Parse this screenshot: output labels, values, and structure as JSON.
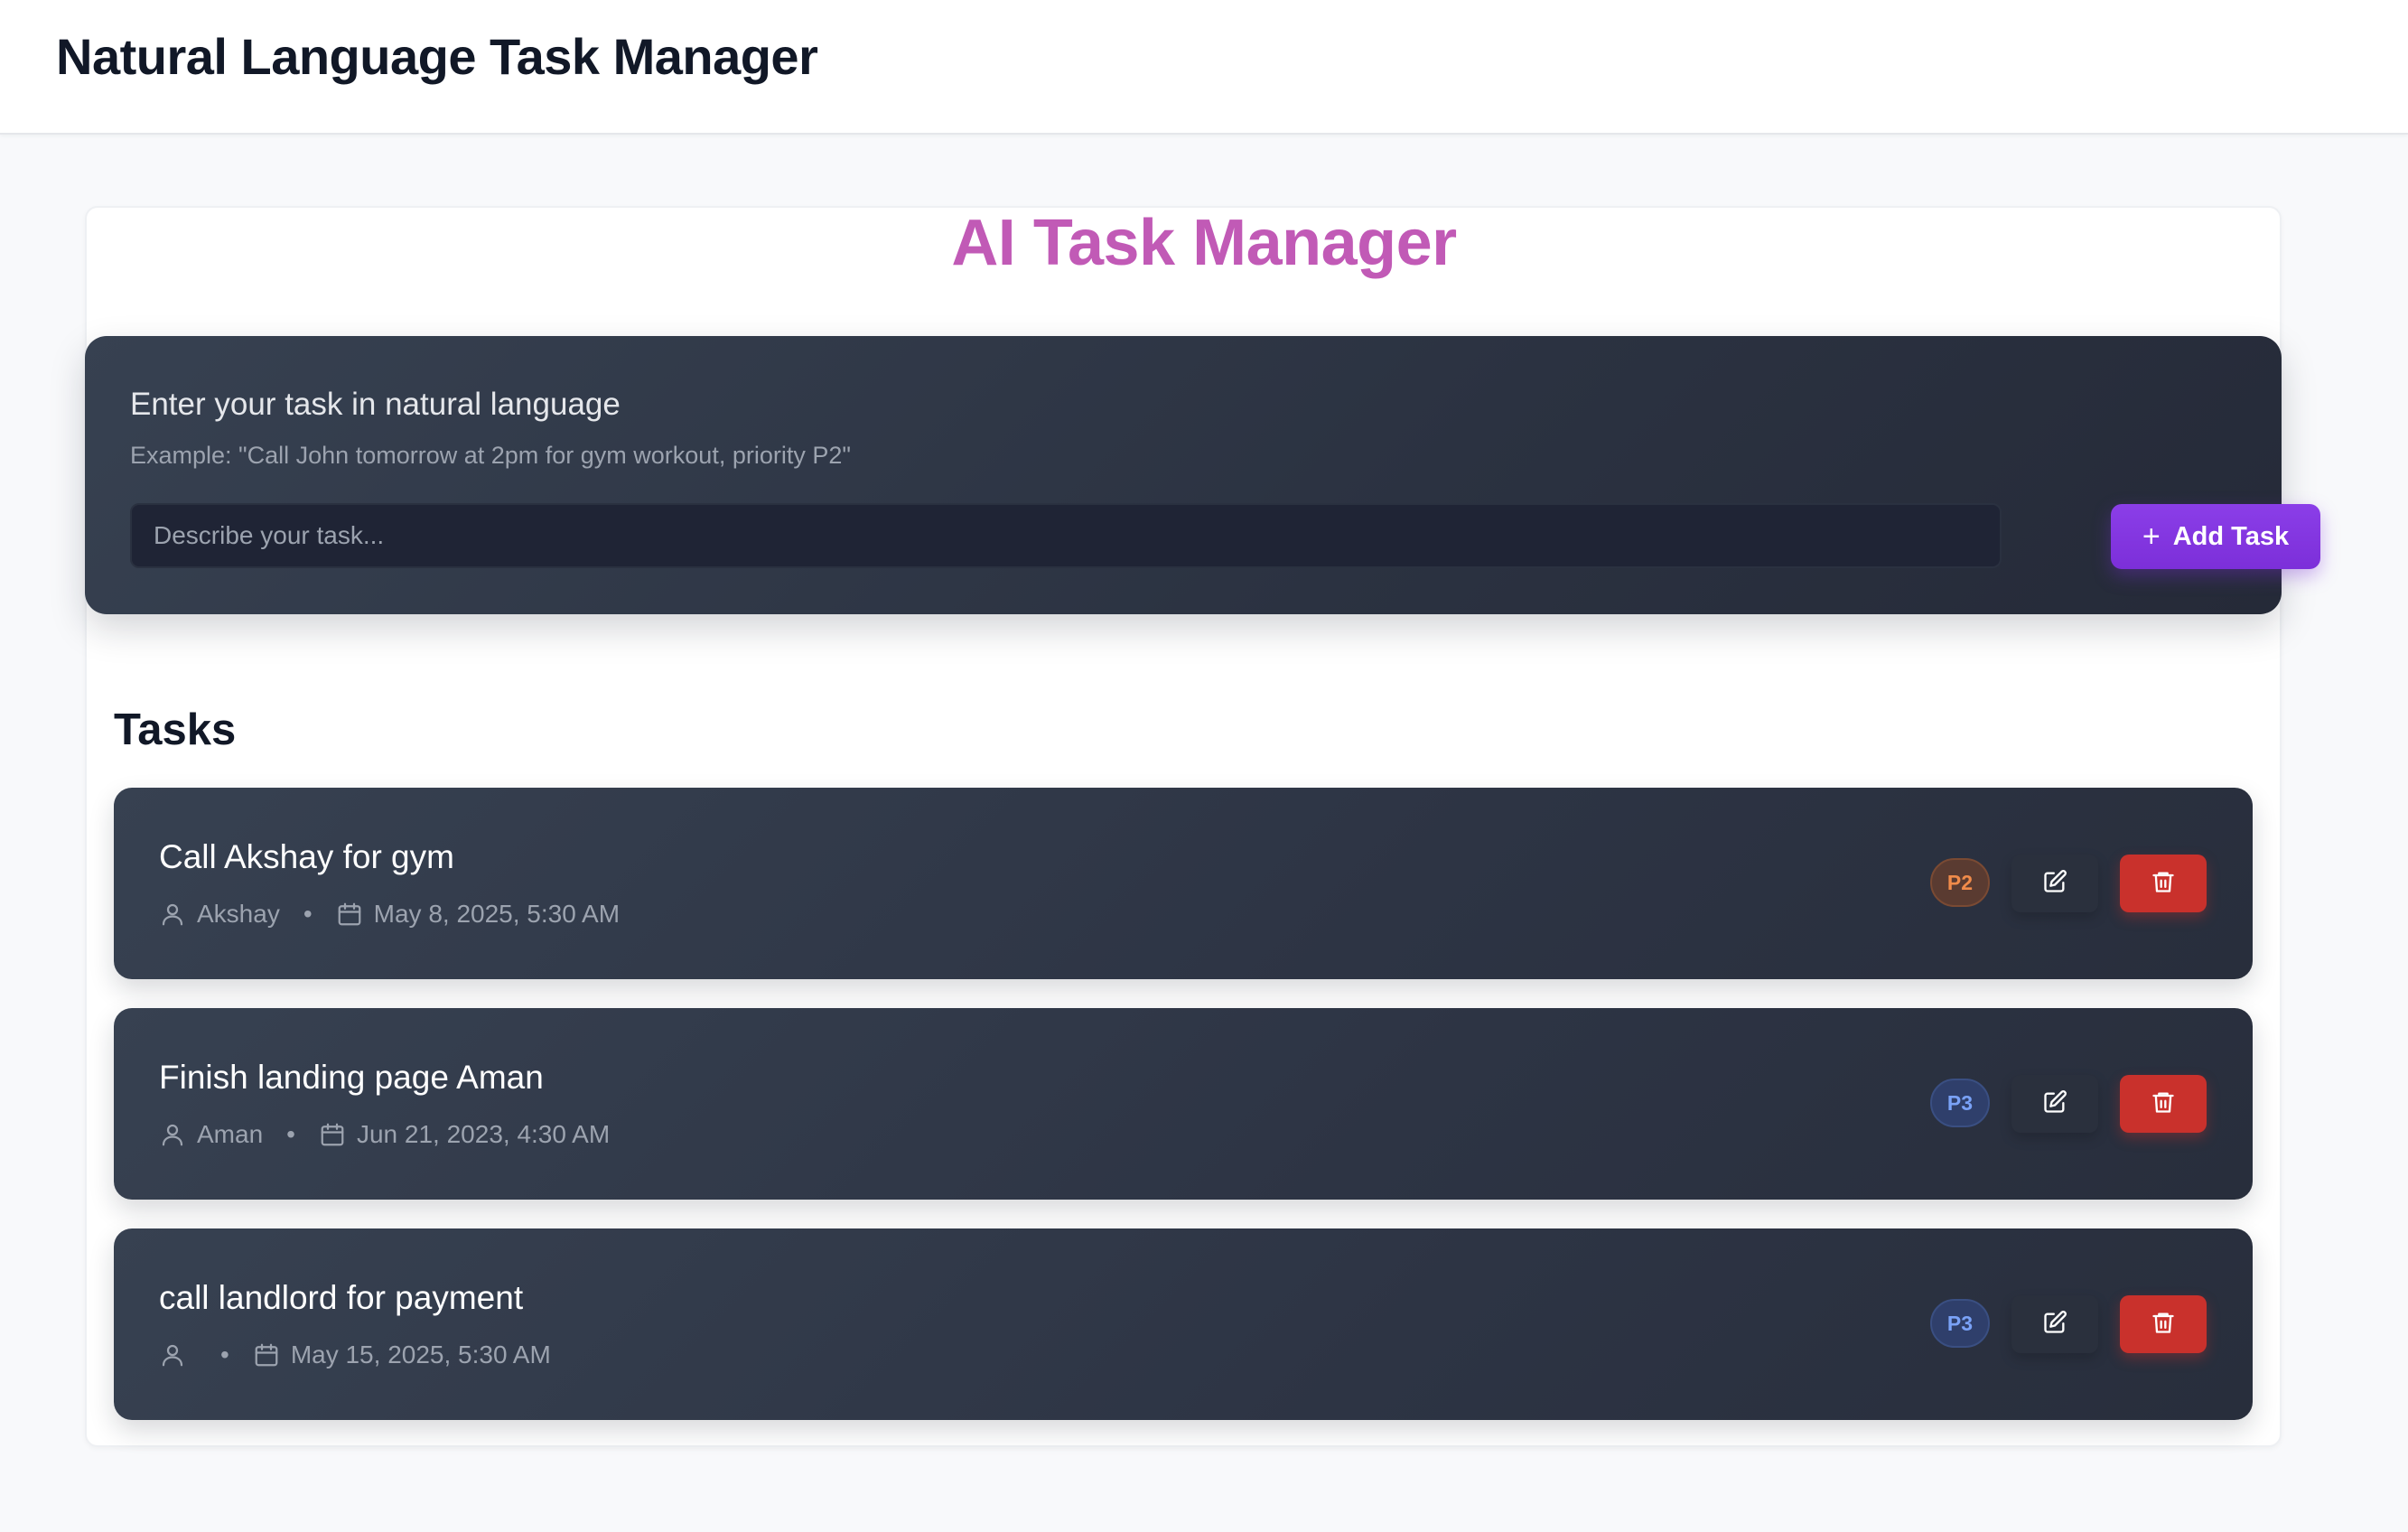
{
  "app": {
    "title": "Natural Language Task Manager"
  },
  "hero": {
    "title": "AI Task Manager"
  },
  "input_card": {
    "label": "Enter your task in natural language",
    "hint": "Example: \"Call John tomorrow at 2pm for gym workout, priority P2\"",
    "input_value": "",
    "input_placeholder": "Describe your task...",
    "add_button_icon": "+",
    "add_button_label": "Add Task"
  },
  "tasks_section": {
    "heading": "Tasks",
    "tasks": [
      {
        "title": "Call Akshay for gym",
        "assignee": "Akshay",
        "separator": "•",
        "due": "May 8, 2025, 5:30 AM",
        "priority": "P2"
      },
      {
        "title": "Finish landing page Aman",
        "assignee": "Aman",
        "separator": "•",
        "due": "Jun 21, 2023, 4:30 AM",
        "priority": "P3"
      },
      {
        "title": "call landlord for payment",
        "assignee": "",
        "separator": "•",
        "due": "May 15, 2025, 5:30 AM",
        "priority": "P3"
      }
    ]
  },
  "icons": {
    "user": "user-icon",
    "calendar": "calendar-icon",
    "edit": "edit-icon",
    "delete": "trash-icon",
    "add": "plus-icon"
  },
  "colors": {
    "hero_title": "#c15ab6",
    "accent": "#7c2fd9",
    "danger": "#c9312c",
    "card_bg": "#374151",
    "priority_p2": "#f08b4a",
    "priority_p3": "#7aa2f7"
  }
}
